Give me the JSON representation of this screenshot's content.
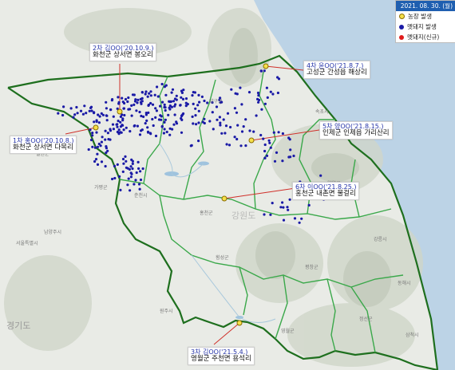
{
  "legend": {
    "date": "2021. 08. 30. (월)",
    "items": [
      {
        "label": "농장 발생",
        "color": "#f5e04a",
        "border": "#8a6d00"
      },
      {
        "label": "멧돼지 발생",
        "color": "#1a1aa6",
        "border": "#1a1aa6"
      },
      {
        "label": "멧돼지(신규)",
        "color": "#e01c1c",
        "border": "#e01c1c"
      }
    ]
  },
  "outbreaks": [
    {
      "id": "outbreak-2",
      "title": "2차 김OO('20.10.9.)",
      "location": "화천군 상서면 봉오리"
    },
    {
      "id": "outbreak-4",
      "title": "4차 윤OO('21.8.7.)",
      "location": "고성군 간성읍 해상리"
    },
    {
      "id": "outbreak-1",
      "title": "1차 홍OO('20.10.8.)",
      "location": "화천군 상서면 다목리"
    },
    {
      "id": "outbreak-5",
      "title": "5차 양OO('21.8.15.)",
      "location": "인제군 인제읍 가리산리"
    },
    {
      "id": "outbreak-6",
      "title": "6차 이OO('21.8.25.)",
      "location": "홍천군 내촌면 물걸리"
    },
    {
      "id": "outbreak-3",
      "title": "3차 김OO('21.5.4.)",
      "location": "영월군 주천면 용석리"
    }
  ],
  "places": [
    "강원도",
    "경기도",
    "서울특별시",
    "남양주시",
    "가평군",
    "홍천군",
    "횡성군",
    "원주시",
    "평창군",
    "정선군",
    "삼척시",
    "강릉시",
    "양양군",
    "속초시",
    "고성군",
    "동해시",
    "영월군",
    "철원군",
    "양구군",
    "춘천시",
    "화천군",
    "인제군"
  ],
  "colors": {
    "province_border": "#1e6f1e",
    "county_border": "#3aa84a",
    "wild_boar": "#1a1aa6",
    "farm": "#f5e04a",
    "leader": "#d0302a"
  }
}
